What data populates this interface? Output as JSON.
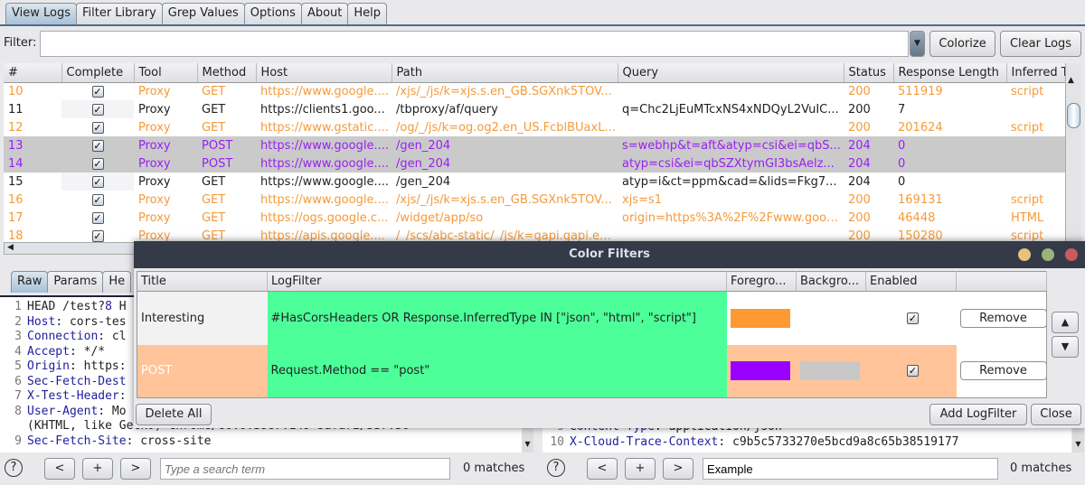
{
  "tabs": [
    "View Logs",
    "Filter Library",
    "Grep Values",
    "Options",
    "About",
    "Help"
  ],
  "filter": {
    "label": "Filter:",
    "value": "",
    "colorize": "Colorize",
    "clear": "Clear Logs"
  },
  "log": {
    "columns": [
      "#",
      "Complete",
      "Tool",
      "Method",
      "Host",
      "Path",
      "Query",
      "Status",
      "Response Length",
      "Inferred T"
    ],
    "rows": [
      {
        "style": "orange",
        "c": [
          "10",
          "✓",
          "Proxy",
          "GET",
          "https://www.google....",
          "/xjs/_/js/k=xjs.s.en_GB.SGXnk5TOV...",
          "",
          "200",
          "511919",
          "script"
        ]
      },
      {
        "style": "plain",
        "c": [
          "11",
          "✓",
          "Proxy",
          "GET",
          "https://clients1.goo...",
          "/tbproxy/af/query",
          "q=Chc2LjEuMTcxNS4xNDQyL2VuIC...",
          "200",
          "7",
          ""
        ]
      },
      {
        "style": "orange",
        "c": [
          "12",
          "✓",
          "Proxy",
          "GET",
          "https://www.gstatic....",
          "/og/_/js/k=og.og2.en_US.FcblBUaxL...",
          "",
          "200",
          "201624",
          "script"
        ]
      },
      {
        "style": "purple",
        "c": [
          "13",
          "✓",
          "Proxy",
          "POST",
          "https://www.google....",
          "/gen_204",
          "s=webhp&t=aft&atyp=csi&ei=qbS...",
          "204",
          "0",
          ""
        ]
      },
      {
        "style": "purple",
        "c": [
          "14",
          "✓",
          "Proxy",
          "POST",
          "https://www.google....",
          "/gen_204",
          "atyp=csi&ei=qbSZXtymGI3bsAelz...",
          "204",
          "0",
          ""
        ]
      },
      {
        "style": "plain",
        "c": [
          "15",
          "✓",
          "Proxy",
          "GET",
          "https://www.google....",
          "/gen_204",
          "atyp=i&ct=ppm&cad=&lids=Fkg7...",
          "204",
          "0",
          ""
        ]
      },
      {
        "style": "orange",
        "c": [
          "16",
          "✓",
          "Proxy",
          "GET",
          "https://www.google....",
          "/xjs/_/js/k=xjs.s.en_GB.SGXnk5TOV...",
          "xjs=s1",
          "200",
          "169131",
          "script"
        ]
      },
      {
        "style": "orange",
        "c": [
          "17",
          "✓",
          "Proxy",
          "GET",
          "https://ogs.google.c...",
          "/widget/app/so",
          "origin=https%3A%2F%2Fwww.googl...",
          "200",
          "46448",
          "HTML"
        ]
      },
      {
        "style": "orange",
        "c": [
          "18",
          "✓",
          "Proxy",
          "GET",
          "https://apis.google....",
          "/_/scs/abc-static/_/js/k=gapi.gapi.en...",
          "",
          "200",
          "150280",
          "script"
        ]
      }
    ]
  },
  "request": {
    "tabs": [
      "Raw",
      "Params",
      "He"
    ],
    "lines": [
      {
        "n": "1",
        "k": "",
        "v": "HEAD /test?",
        "hl": "8",
        "rest": " H"
      },
      {
        "n": "2",
        "k": "Host",
        "v": ": cors-tes"
      },
      {
        "n": "3",
        "k": "Connection",
        "v": ": cl"
      },
      {
        "n": "4",
        "k": "Accept",
        "v": ": */*"
      },
      {
        "n": "5",
        "k": "Origin",
        "v": ": https:"
      },
      {
        "n": "6",
        "k": "Sec-Fetch-Dest",
        "v": ""
      },
      {
        "n": "7",
        "k": "X-Test-Header",
        "v": ":"
      },
      {
        "n": "8",
        "k": "User-Agent",
        "v": ": Mo"
      },
      {
        "n": "",
        "k": "",
        "v": "(KHTML, like Gecko) Chrome/80.0.3987.149 Safari/537.36"
      },
      {
        "n": "9",
        "k": "Sec-Fetch-Site",
        "v": ": cross-site"
      }
    ],
    "search_placeholder": "Type a search term",
    "matches": "0 matches"
  },
  "response": {
    "lines": [
      {
        "n": "9",
        "k": "Content-Type",
        "v": ": application/json"
      },
      {
        "n": "10",
        "k": "X-Cloud-Trace-Context",
        "v": ": c9b5c5733270e5bcd9a8c65b38519177"
      }
    ],
    "search_value": "Example",
    "matches": "0 matches"
  },
  "nav": {
    "prev": "<",
    "add": "+",
    "next": ">",
    "help": "?"
  },
  "dialog": {
    "title": "Color Filters",
    "columns": [
      "Title",
      "LogFilter",
      "Foregro...",
      "Backgro...",
      "Enabled",
      ""
    ],
    "filters": [
      {
        "title": "Interesting",
        "filter": "#HasCorsHeaders OR Response.InferredType IN [\"json\", \"html\", \"script\"]",
        "fg": "#ff9933",
        "bg": "",
        "enabled": true,
        "remove": "Remove",
        "row_bg": "#f2f2f2",
        "title_color": "#222"
      },
      {
        "title": "POST",
        "filter": "Request.Method == \"post\"",
        "fg": "#9900ff",
        "bg": "#c8c8c8",
        "enabled": true,
        "remove": "Remove",
        "row_bg": "#ffc499",
        "title_color": "#ffffff"
      }
    ],
    "filter_cell_bg": "#4dff99",
    "delete_all": "Delete All",
    "add": "Add LogFilter",
    "close": "Close",
    "up": "▲",
    "down": "▼"
  }
}
